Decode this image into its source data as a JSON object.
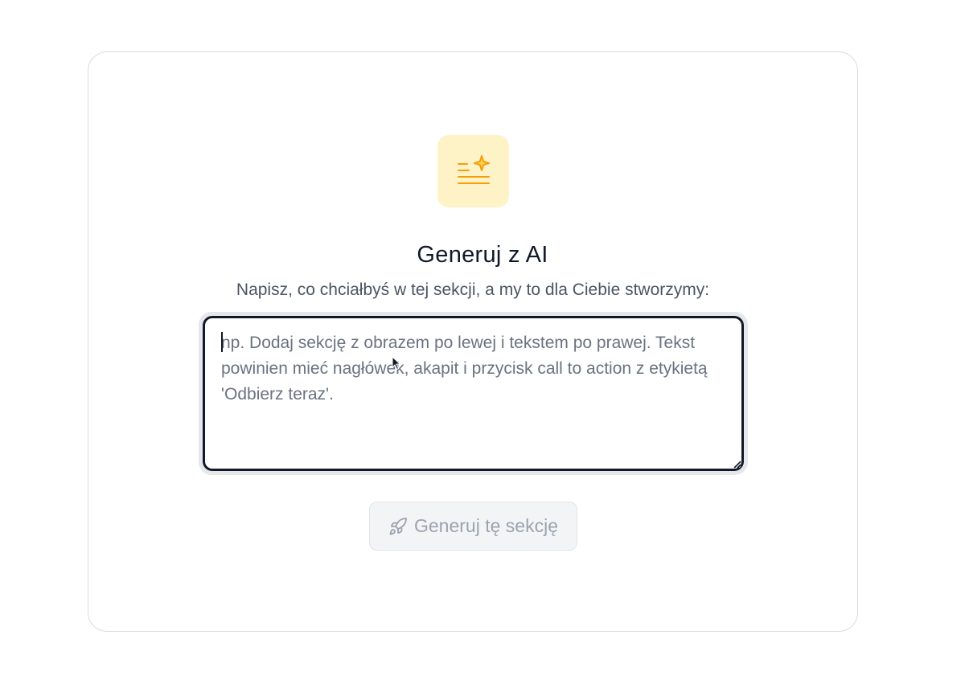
{
  "dialog": {
    "title": "Generuj z AI",
    "subtitle": "Napisz, co chciałbyś w tej sekcji, a my to dla Ciebie stworzymy:",
    "icon": "ai-text-sparkle-icon",
    "accent_color": "#f59e0b",
    "icon_background": "#fef3c7"
  },
  "prompt_input": {
    "value": "",
    "placeholder": "np. Dodaj sekcję z obrazem po lewej i tekstem po prawej. Tekst powinien mieć nagłówek, akapit i przycisk call to action z etykietą 'Odbierz teraz'."
  },
  "generate_button": {
    "label": "Generuj tę sekcję",
    "icon": "rocket-icon",
    "disabled": true
  }
}
